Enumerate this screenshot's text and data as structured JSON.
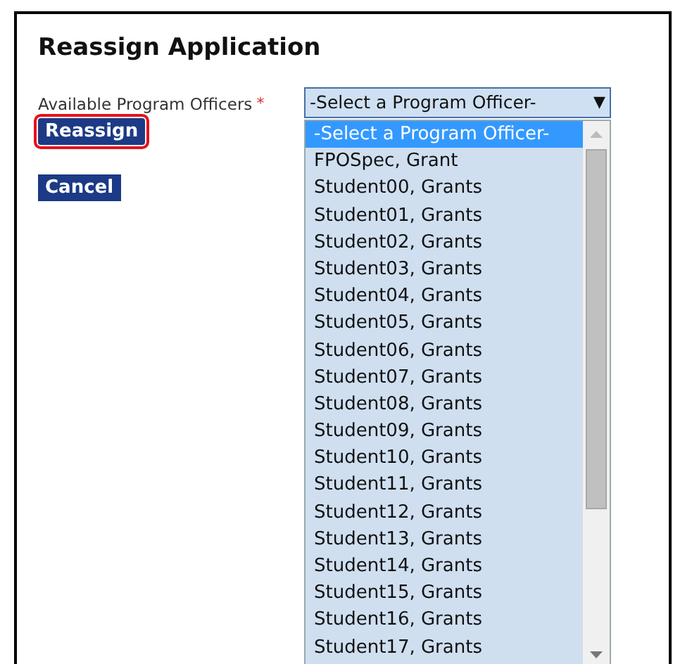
{
  "title": "Reassign Application",
  "field": {
    "label": "Available Program Officers",
    "required_mark": "*",
    "value": "-Select a Program Officer-",
    "arrow": "▼"
  },
  "options": [
    {
      "label": "-Select a Program Officer-",
      "selected": true
    },
    {
      "label": "FPOSpec, Grant",
      "selected": false
    },
    {
      "label": "Student00, Grants",
      "selected": false
    },
    {
      "label": "Student01, Grants",
      "selected": false
    },
    {
      "label": "Student02, Grants",
      "selected": false
    },
    {
      "label": "Student03, Grants",
      "selected": false
    },
    {
      "label": "Student04, Grants",
      "selected": false
    },
    {
      "label": "Student05, Grants",
      "selected": false
    },
    {
      "label": "Student06, Grants",
      "selected": false
    },
    {
      "label": "Student07, Grants",
      "selected": false
    },
    {
      "label": "Student08, Grants",
      "selected": false
    },
    {
      "label": "Student09, Grants",
      "selected": false
    },
    {
      "label": "Student10, Grants",
      "selected": false
    },
    {
      "label": "Student11, Grants",
      "selected": false
    },
    {
      "label": "Student12, Grants",
      "selected": false
    },
    {
      "label": "Student13, Grants",
      "selected": false
    },
    {
      "label": "Student14, Grants",
      "selected": false
    },
    {
      "label": "Student15, Grants",
      "selected": false
    },
    {
      "label": "Student16, Grants",
      "selected": false
    },
    {
      "label": "Student17, Grants",
      "selected": false
    }
  ],
  "buttons": [
    {
      "label": "Reassign",
      "highlighted": true
    },
    {
      "label": "Cancel",
      "highlighted": false
    }
  ]
}
